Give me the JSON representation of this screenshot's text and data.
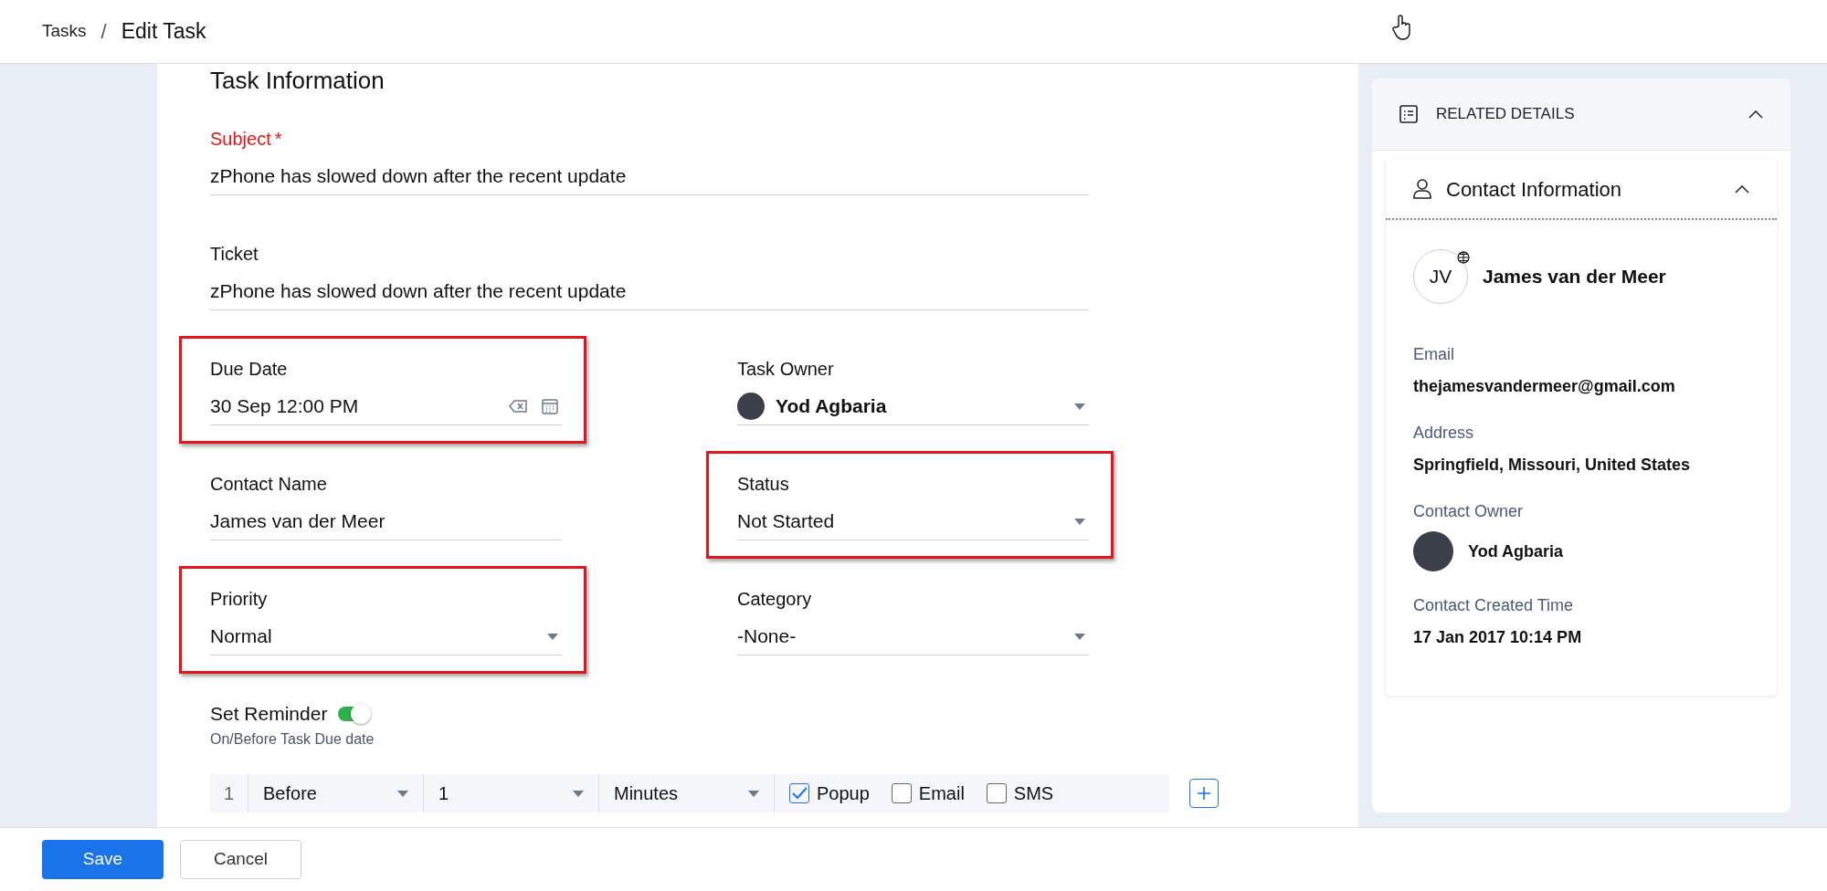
{
  "breadcrumb": {
    "parent": "Tasks",
    "separator": "/",
    "current": "Edit Task"
  },
  "section_title": "Task Information",
  "rows": [
    [
      {
        "kind": "text",
        "label": "Subject",
        "required_mark": "*",
        "value": "zPhone has slowed down after the recent update",
        "highlighted": false
      }
    ],
    [
      {
        "kind": "text",
        "label": "Ticket",
        "value": "zPhone has slowed down after the recent update",
        "highlighted": false
      }
    ],
    [
      {
        "kind": "datetime",
        "label": "Due Date",
        "value": "30 Sep 12:00 PM",
        "highlighted": true
      },
      {
        "kind": "user",
        "label": "Task Owner",
        "value": "Yod Agbaria",
        "highlighted": false
      }
    ],
    [
      {
        "kind": "text",
        "label": "Contact Name",
        "value": "James van der Meer",
        "highlighted": false
      },
      {
        "kind": "select",
        "label": "Status",
        "value": "Not Started",
        "highlighted": true
      }
    ],
    [
      {
        "kind": "select",
        "label": "Priority",
        "value": "Normal",
        "highlighted": true
      },
      {
        "kind": "select",
        "label": "Category",
        "value": "-None-",
        "highlighted": false
      }
    ]
  ],
  "reminder": {
    "label": "Set Reminder",
    "on": true,
    "hint": "On/Before Task Due date",
    "rows": [
      {
        "index": "1",
        "when": "Before",
        "amount": "1",
        "unit": "Minutes",
        "channels": [
          {
            "label": "Popup",
            "checked": true
          },
          {
            "label": "Email",
            "checked": false
          },
          {
            "label": "SMS",
            "checked": false
          }
        ]
      }
    ]
  },
  "buttons": [
    {
      "label": "Save",
      "kind": "primary"
    },
    {
      "label": "Cancel",
      "kind": "secondary"
    }
  ],
  "related": {
    "title": "RELATED DETAILS",
    "expanded": true,
    "contact": {
      "title": "Contact Information",
      "expanded": true,
      "initials": "JV",
      "name": "James van der Meer",
      "details": [
        {
          "kind": "text",
          "label": "Email",
          "value": "thejamesvandermeer@gmail.com"
        },
        {
          "kind": "text",
          "label": "Address",
          "value": "Springfield, Missouri, United States"
        },
        {
          "kind": "user",
          "label": "Contact Owner",
          "value": "Yod Agbaria"
        },
        {
          "kind": "text",
          "label": "Contact Created Time",
          "value": "17 Jan 2017 10:14 PM"
        }
      ]
    }
  }
}
